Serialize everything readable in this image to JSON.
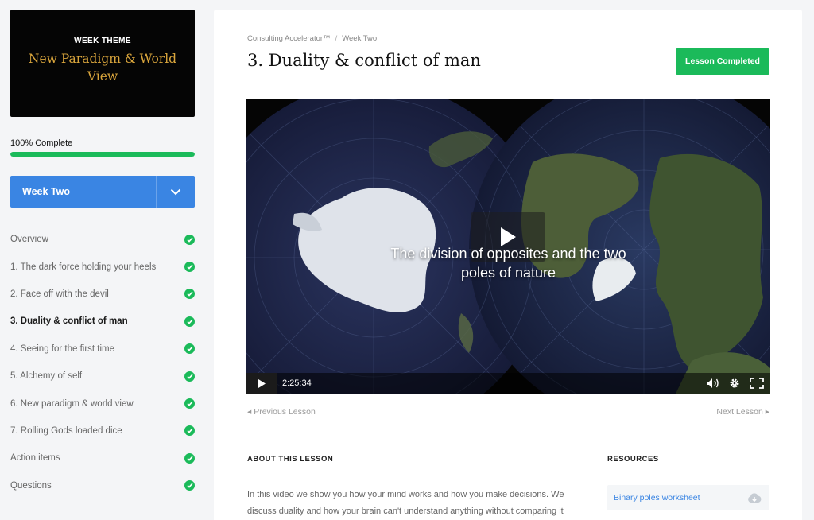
{
  "sidebar": {
    "theme_kicker": "WEEK THEME",
    "theme_title": "New Paradigm & World View",
    "progress_label": "100% Complete",
    "progress_value": 1.0,
    "week_select": "Week Two",
    "lessons": [
      {
        "label": "Overview",
        "completed": true
      },
      {
        "label": "1. The dark force holding your heels",
        "completed": true
      },
      {
        "label": "2. Face off with the devil",
        "completed": true
      },
      {
        "label": "3. Duality & conflict of man",
        "completed": true,
        "active": true
      },
      {
        "label": "4. Seeing for the first time",
        "completed": true
      },
      {
        "label": "5. Alchemy of self",
        "completed": true
      },
      {
        "label": "6. New paradigm & world view",
        "completed": true
      },
      {
        "label": "7. Rolling Gods loaded dice",
        "completed": true
      },
      {
        "label": "Action items",
        "completed": true
      },
      {
        "label": "Questions",
        "completed": true
      }
    ]
  },
  "main": {
    "breadcrumb": [
      "Consulting Accelerator™",
      "Week Two"
    ],
    "breadcrumb_separator": "/",
    "title": "3. Duality & conflict of man",
    "complete_button": "Lesson Completed",
    "video": {
      "caption_line1": "The division of opposites and the two",
      "caption_line2": "poles of nature",
      "time": "2:25:34"
    },
    "prev_lesson": "Previous Lesson",
    "next_lesson": "Next Lesson",
    "about_heading": "ABOUT THIS LESSON",
    "about_text": "In this video we show you how your mind works and how you make decisions. We discuss duality and how your brain can't understand anything without comparing it",
    "resources_heading": "RESOURCES",
    "resources": [
      {
        "label": "Binary poles worksheet",
        "icon": "cloud-download-icon"
      }
    ]
  },
  "colors": {
    "accent_green": "#1bba5a",
    "accent_blue": "#3a85e3",
    "theme_gold": "#d9a53c"
  }
}
